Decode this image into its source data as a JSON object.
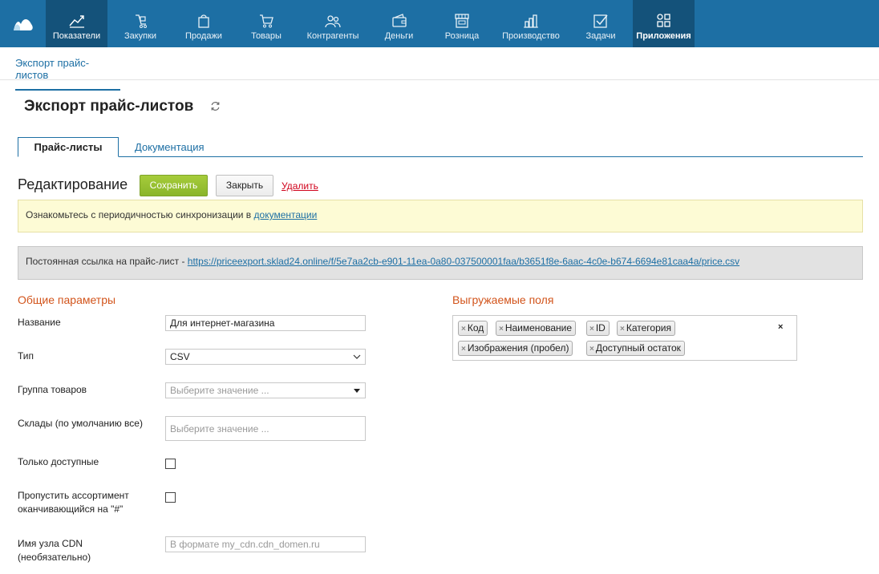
{
  "nav": {
    "items": [
      {
        "label": "Показатели",
        "icon": "chart-line-icon"
      },
      {
        "label": "Закупки",
        "icon": "purchase-icon"
      },
      {
        "label": "Продажи",
        "icon": "shopping-bag-icon"
      },
      {
        "label": "Товары",
        "icon": "cart-icon"
      },
      {
        "label": "Контрагенты",
        "icon": "people-icon"
      },
      {
        "label": "Деньги",
        "icon": "wallet-icon"
      },
      {
        "label": "Розница",
        "icon": "store-icon"
      },
      {
        "label": "Производство",
        "icon": "factory-icon"
      },
      {
        "label": "Задачи",
        "icon": "checkbox-icon"
      },
      {
        "label": "Приложения",
        "icon": "apps-icon"
      }
    ]
  },
  "breadcrumb": "Экспорт прайс-листов",
  "page_title": "Экспорт прайс-листов",
  "tabs": [
    {
      "label": "Прайс-листы"
    },
    {
      "label": "Документация"
    }
  ],
  "edit": {
    "title": "Редактирование",
    "save_label": "Сохранить",
    "close_label": "Закрыть",
    "delete_label": "Удалить"
  },
  "notice": {
    "text": "Ознакомьтесь с периодичностью синхронизации в ",
    "link": "документации"
  },
  "permalink": {
    "text": "Постоянная ссылка на прайс-лист - ",
    "url": "https://priceexport.sklad24.online/f/5e7aa2cb-e901-11ea-0a80-037500001faa/b3651f8e-6aac-4c0e-b674-6694e81caa4a/price.csv"
  },
  "general": {
    "title": "Общие параметры",
    "name_label": "Название",
    "name_value": "Для интернет-магазина",
    "type_label": "Тип",
    "type_value": "CSV",
    "group_label": "Группа товаров",
    "group_placeholder": "Выберите значение ...",
    "warehouses_label": "Склады (по умолчанию все)",
    "warehouses_placeholder": "Выберите значение ...",
    "only_available_label": "Только доступные",
    "skip_label_1": "Пропустить ассортимент",
    "skip_label_2": "оканчивающийся на \"#\"",
    "cdn_label_1": "Имя узла CDN",
    "cdn_label_2": "(необязательно)",
    "cdn_placeholder": "В формате my_cdn.cdn_domen.ru"
  },
  "fields": {
    "title": "Выгружаемые поля",
    "chips": [
      "Код",
      "Наименование",
      "ID",
      "Категория",
      "Изображения (пробел)",
      "Доступный остаток"
    ],
    "clear_symbol": "×",
    "remove_symbol": "×"
  }
}
